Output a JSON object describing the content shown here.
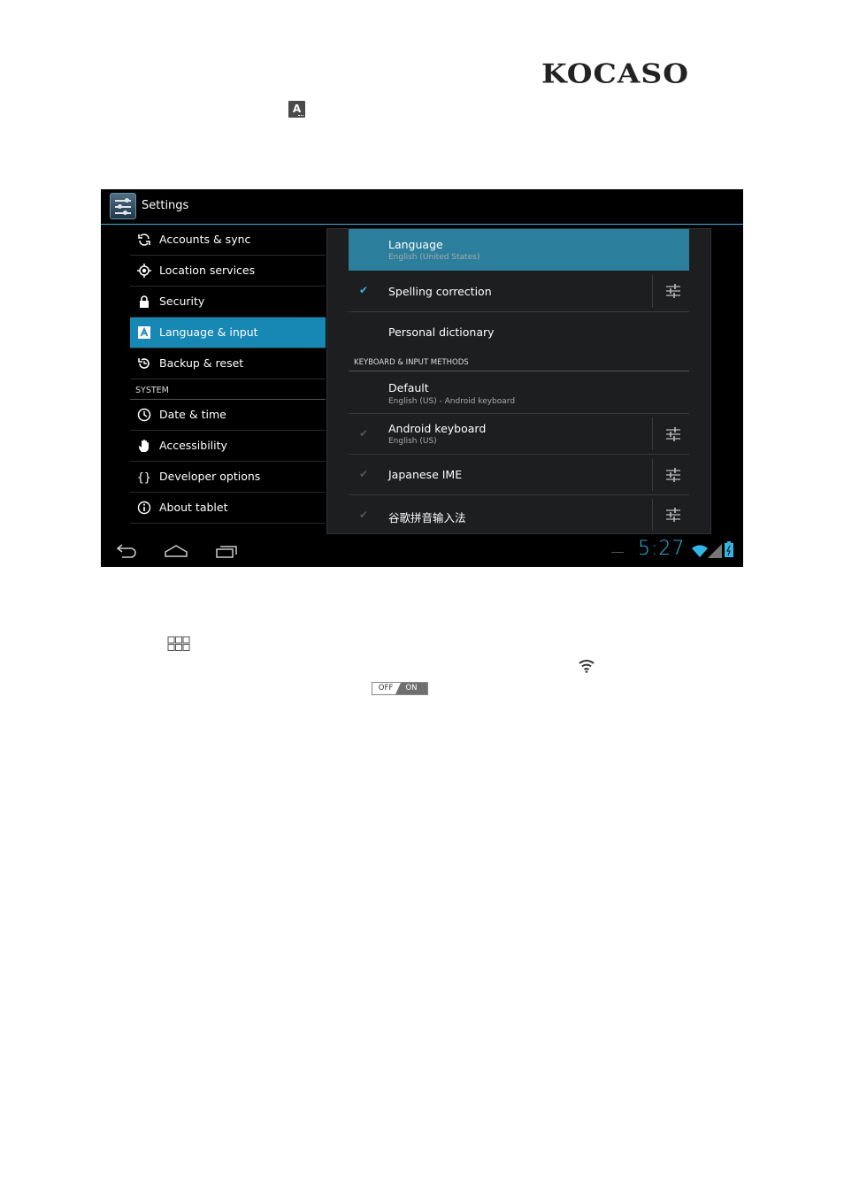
{
  "doc": {
    "logo": "KOCASO",
    "inline_icon_letter": "A",
    "toggle_off": "OFF",
    "toggle_on": "ON"
  },
  "screen": {
    "app_title": "Settings",
    "left_menu": [
      {
        "label": "Accounts & sync",
        "icon": "sync-icon"
      },
      {
        "label": "Location services",
        "icon": "location-icon"
      },
      {
        "label": "Security",
        "icon": "lock-icon"
      },
      {
        "label": "Language & input",
        "icon": "language-icon",
        "selected": true
      },
      {
        "label": "Backup & reset",
        "icon": "backup-icon"
      }
    ],
    "system_section": "SYSTEM",
    "system_menu": [
      {
        "label": "Date & time",
        "icon": "clock-icon"
      },
      {
        "label": "Accessibility",
        "icon": "hand-icon"
      },
      {
        "label": "Developer options",
        "icon": "braces-icon"
      },
      {
        "label": "About tablet",
        "icon": "info-icon"
      }
    ],
    "right": {
      "language_title": "Language",
      "language_value": "English (United States)",
      "spelling": "Spelling correction",
      "dictionary": "Personal dictionary",
      "keyboard_section": "KEYBOARD & INPUT METHODS",
      "default_title": "Default",
      "default_value": "English (US) - Android keyboard",
      "android_kb": "Android keyboard",
      "android_kb_sub": "English (US)",
      "japanese": "Japanese IME",
      "pinyin": "谷歌拼音输入法"
    },
    "clock": "5:27",
    "accent_color": "#33b5e5"
  }
}
